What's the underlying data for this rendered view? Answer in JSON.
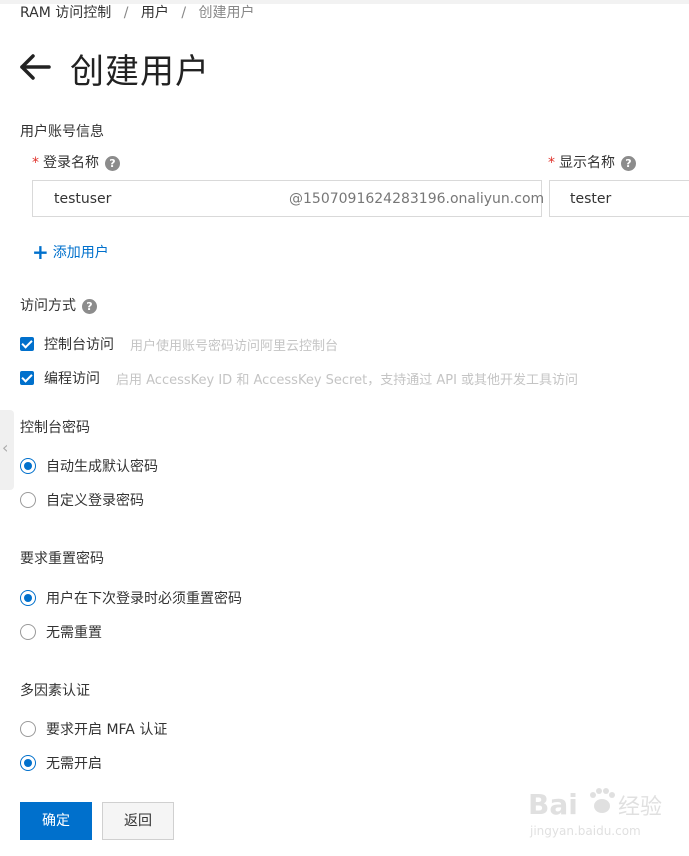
{
  "breadcrumb": {
    "item1": "RAM 访问控制",
    "item2": "用户",
    "current": "创建用户",
    "separator": "/"
  },
  "page": {
    "title": "创建用户",
    "back_icon": "arrow-left-icon"
  },
  "account_info": {
    "section_label": "用户账号信息",
    "login_name_label": "登录名称",
    "login_name_value": "testuser",
    "login_name_suffix": "@1507091624283196.onaliyun.com",
    "display_name_label": "显示名称",
    "display_name_value": "tester",
    "required_mark": "*",
    "help_glyph": "?",
    "add_user_label": "添加用户",
    "add_icon": "+"
  },
  "access_mode": {
    "section_label": "访问方式",
    "console_label": "控制台访问",
    "console_hint": "用户使用账号密码访问阿里云控制台",
    "console_checked": true,
    "program_label": "编程访问",
    "program_hint": "启用 AccessKey ID 和 AccessKey Secret，支持通过 API 或其他开发工具访问",
    "program_checked": true
  },
  "console_password": {
    "section_label": "控制台密码",
    "options": [
      "自动生成默认密码",
      "自定义登录密码"
    ],
    "selected": 0
  },
  "reset_password": {
    "section_label": "要求重置密码",
    "options": [
      "用户在下次登录时必须重置密码",
      "无需重置"
    ],
    "selected": 0
  },
  "mfa": {
    "section_label": "多因素认证",
    "options": [
      "要求开启 MFA 认证",
      "无需开启"
    ],
    "selected": 1
  },
  "actions": {
    "confirm_label": "确定",
    "back_label": "返回"
  },
  "side_tab": {
    "icon": "chevron-left-icon",
    "glyph": "‹"
  },
  "watermark": {
    "text1": "Bai",
    "text2": "经验",
    "url": "jingyan.baidu.com"
  },
  "colors": {
    "accent": "#0070cc",
    "required": "#e0312a",
    "hint": "#c4c4c4"
  }
}
